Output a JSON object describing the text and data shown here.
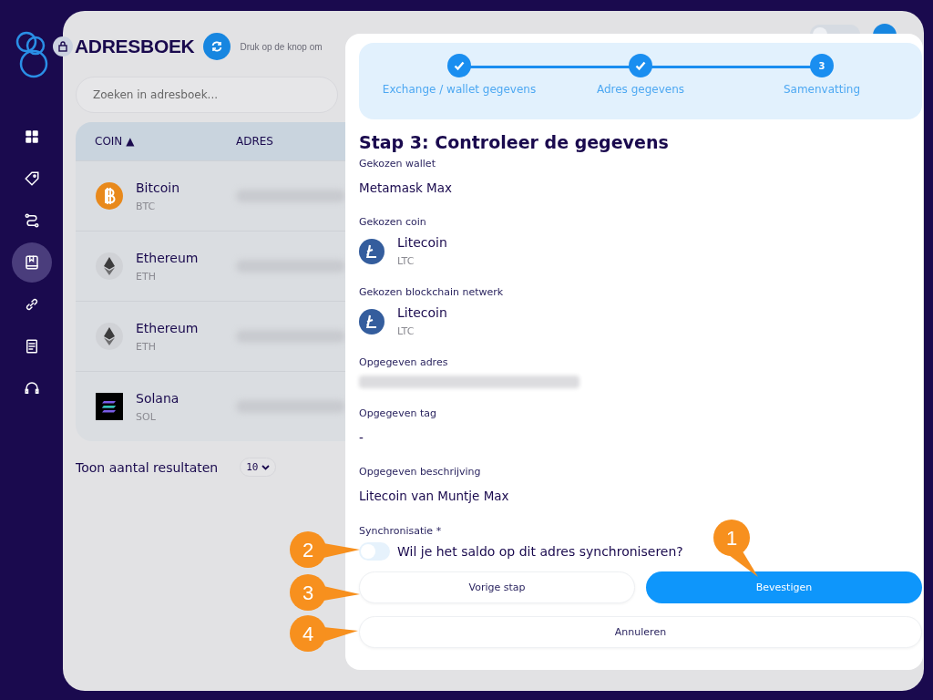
{
  "sidebar": {
    "items": [
      {
        "kind": "grid",
        "selected": false
      },
      {
        "kind": "tag",
        "selected": false
      },
      {
        "kind": "route",
        "selected": false
      },
      {
        "kind": "book",
        "selected": true
      },
      {
        "kind": "link",
        "selected": false
      },
      {
        "kind": "document",
        "selected": false
      },
      {
        "kind": "support",
        "selected": false
      }
    ]
  },
  "header": {
    "title": "ADRESBOEK",
    "hint": "Druk op de knop om",
    "theme_toggle": {
      "on": false
    }
  },
  "search": {
    "placeholder": "Zoeken in adresboek..."
  },
  "table": {
    "columns": [
      "COIN ▲",
      "ADRES"
    ],
    "rows": [
      {
        "kind": "btc",
        "name": "Bitcoin",
        "ticker": "BTC"
      },
      {
        "kind": "eth",
        "name": "Ethereum",
        "ticker": "ETH"
      },
      {
        "kind": "eth",
        "name": "Ethereum",
        "ticker": "ETH"
      },
      {
        "kind": "sol",
        "name": "Solana",
        "ticker": "SOL"
      }
    ]
  },
  "pagination": {
    "label": "Toon aantal resultaten",
    "value": "10"
  },
  "modal": {
    "steps": [
      {
        "label": "Exchange / wallet gegevens",
        "done": true
      },
      {
        "label": "Adres gegevens",
        "done": true
      },
      {
        "label": "Samenvatting",
        "done": false,
        "number": "3"
      }
    ],
    "title": "Stap 3: Controleer de gegevens",
    "fields": [
      {
        "kind": "text",
        "label": "Gekozen wallet",
        "value": "Metamask Max"
      },
      {
        "kind": "coin",
        "label": "Gekozen coin",
        "value": "Litecoin",
        "ticker": "LTC"
      },
      {
        "kind": "coin",
        "label": "Gekozen blockchain netwerk",
        "value": "Litecoin",
        "ticker": "LTC"
      },
      {
        "kind": "redacted",
        "label": "Opgegeven adres"
      },
      {
        "kind": "text",
        "label": "Opgegeven tag",
        "value": "-"
      },
      {
        "kind": "text",
        "label": "Opgegeven beschrijving",
        "value": "Litecoin van Muntje Max"
      }
    ],
    "sync": {
      "label": "Synchronisatie *",
      "question": "Wil je het saldo op dit adres synchroniseren?",
      "on": false
    },
    "buttons": [
      {
        "kind": "secondary",
        "label": "Vorige stap"
      },
      {
        "kind": "primary",
        "label": "Bevestigen"
      },
      {
        "kind": "secondary",
        "label": "Annuleren"
      }
    ]
  },
  "callouts": [
    {
      "label": "2"
    },
    {
      "label": "3"
    },
    {
      "label": "4"
    },
    {
      "label": "1"
    }
  ]
}
